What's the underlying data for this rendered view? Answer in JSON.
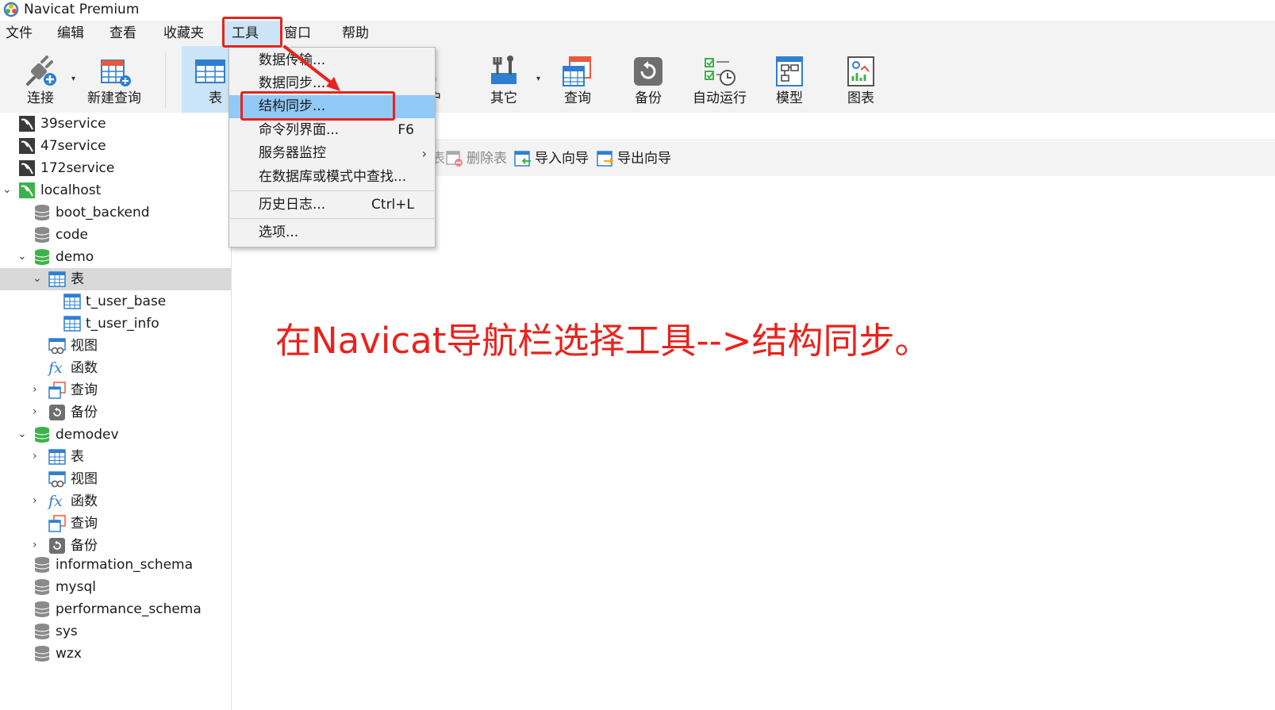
{
  "window": {
    "title": "Navicat Premium"
  },
  "menubar": [
    "文件",
    "编辑",
    "查看",
    "收藏夹",
    "工具",
    "窗口",
    "帮助"
  ],
  "toolbar": {
    "connect": "连接",
    "new_query": "新建查询",
    "table": "表",
    "hidden_label": "户",
    "other": "其它",
    "query": "查询",
    "backup": "备份",
    "autorun": "自动运行",
    "model": "模型",
    "chart": "图表"
  },
  "tools_menu": {
    "items": [
      {
        "label": "数据传输...",
        "shortcut": ""
      },
      {
        "label": "数据同步...",
        "shortcut": ""
      },
      {
        "label": "结构同步...",
        "shortcut": ""
      },
      {
        "label": "命令列界面...",
        "shortcut": "F6"
      },
      {
        "label": "服务器监控",
        "shortcut": ""
      },
      {
        "label": "在数据库或模式中查找...",
        "shortcut": ""
      },
      {
        "label": "历史日志...",
        "shortcut": "Ctrl+L"
      },
      {
        "label": "选项...",
        "shortcut": ""
      }
    ]
  },
  "sidebar": {
    "items": [
      {
        "label": "39service"
      },
      {
        "label": "47service"
      },
      {
        "label": "172service"
      },
      {
        "label": "localhost"
      },
      {
        "label": "boot_backend"
      },
      {
        "label": "code"
      },
      {
        "label": "demo"
      },
      {
        "label": "表"
      },
      {
        "label": "t_user_base"
      },
      {
        "label": "t_user_info"
      },
      {
        "label": "视图"
      },
      {
        "label": "函数"
      },
      {
        "label": "查询"
      },
      {
        "label": "备份"
      },
      {
        "label": "demodev"
      },
      {
        "label": "表"
      },
      {
        "label": "视图"
      },
      {
        "label": "函数"
      },
      {
        "label": "查询"
      },
      {
        "label": "备份"
      },
      {
        "label": "information_schema"
      },
      {
        "label": "mysql"
      },
      {
        "label": "performance_schema"
      },
      {
        "label": "sys"
      },
      {
        "label": "wzx"
      }
    ]
  },
  "object_toolbar": {
    "partial": "表",
    "delete_table": "删除表",
    "import_wizard": "导入向导",
    "export_wizard": "导出向导"
  },
  "annotation": {
    "text": "在Navicat导航栏选择工具-->结构同步。"
  },
  "colors": {
    "annotation_red": "#e8231c",
    "menu_highlight": "#91c9f7",
    "db_green": "#3cb34a",
    "table_blue": "#2f7fd1"
  }
}
